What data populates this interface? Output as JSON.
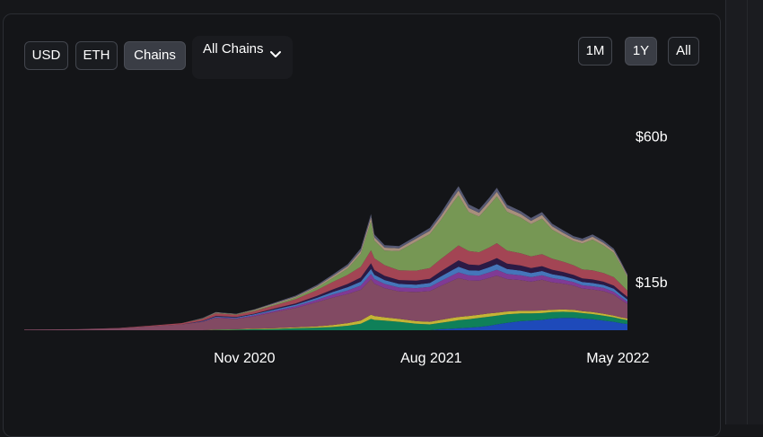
{
  "toolbar": {
    "currency_buttons": [
      "USD",
      "ETH",
      "Chains"
    ],
    "active_currency": "Chains",
    "chain_select": "All Chains",
    "range_buttons": [
      "1M",
      "1Y",
      "All"
    ],
    "active_range": "1Y"
  },
  "chart_data": {
    "type": "area",
    "stacked": true,
    "y_ticks": [
      "$60b",
      "$15b"
    ],
    "y_tick_values": [
      60,
      15
    ],
    "ylim": [
      0,
      66
    ],
    "x_ticks": [
      "Nov 2020",
      "Aug 2021",
      "May 2022"
    ],
    "x_tick_dates": [
      "2020-11-01",
      "2021-08-01",
      "2022-05-01"
    ],
    "x_range": [
      "2019-12-15",
      "2022-05-15"
    ],
    "grid": false,
    "legend": "none",
    "x": [
      "2019-12-15",
      "2020-03-01",
      "2020-05-01",
      "2020-06-15",
      "2020-08-01",
      "2020-09-01",
      "2020-09-20",
      "2020-10-20",
      "2020-11-15",
      "2020-12-15",
      "2021-01-15",
      "2021-02-15",
      "2021-03-10",
      "2021-04-01",
      "2021-04-20",
      "2021-05-05",
      "2021-05-10",
      "2021-05-25",
      "2021-06-15",
      "2021-07-10",
      "2021-07-30",
      "2021-08-15",
      "2021-09-01",
      "2021-09-10",
      "2021-09-25",
      "2021-10-10",
      "2021-10-25",
      "2021-11-05",
      "2021-11-20",
      "2021-12-10",
      "2021-12-25",
      "2022-01-10",
      "2022-01-25",
      "2022-02-10",
      "2022-02-25",
      "2022-03-10",
      "2022-03-25",
      "2022-04-10",
      "2022-04-25",
      "2022-05-05",
      "2022-05-15"
    ],
    "series": [
      {
        "color": "#1f4fc9",
        "values": [
          0,
          0,
          0,
          0,
          0,
          0,
          0,
          0,
          0,
          0,
          0,
          0,
          0,
          0,
          0,
          0,
          0,
          0,
          0,
          0,
          0,
          0.3,
          0.5,
          0.6,
          0.8,
          1.0,
          1.4,
          1.8,
          2.3,
          2.8,
          3.0,
          3.2,
          3.6,
          3.8,
          3.8,
          3.6,
          3.4,
          3.0,
          2.6,
          2.2,
          1.9
        ]
      },
      {
        "color": "#0f8a5f",
        "values": [
          0,
          0,
          0,
          0,
          0,
          0,
          0.1,
          0.2,
          0.3,
          0.4,
          0.6,
          0.8,
          1.0,
          1.4,
          2.0,
          3.5,
          3.2,
          3.0,
          2.6,
          2.0,
          1.8,
          2.0,
          2.3,
          2.5,
          2.6,
          2.8,
          2.8,
          2.7,
          2.6,
          2.4,
          2.2,
          2.1,
          2.0,
          1.9,
          1.8,
          1.7,
          1.6,
          1.5,
          1.4,
          1.3,
          1.2
        ]
      },
      {
        "color": "#d4c23a",
        "values": [
          0,
          0,
          0,
          0,
          0,
          0,
          0.1,
          0.1,
          0.2,
          0.2,
          0.3,
          0.4,
          0.6,
          0.8,
          1.0,
          1.3,
          1.2,
          1.0,
          0.9,
          0.8,
          0.8,
          0.9,
          1.0,
          1.0,
          1.0,
          1.0,
          1.0,
          0.9,
          0.9,
          0.8,
          0.8,
          0.8,
          0.7,
          0.7,
          0.7,
          0.6,
          0.6,
          0.6,
          0.5,
          0.5,
          0.5
        ]
      },
      {
        "color": "#8c4f6a",
        "values": [
          0.2,
          0.3,
          0.6,
          1.2,
          1.8,
          2.6,
          3.6,
          3.2,
          3.8,
          5.0,
          6.0,
          7.5,
          8.5,
          9.0,
          9.5,
          11.0,
          10.0,
          9.0,
          8.5,
          9.0,
          9.5,
          10.5,
          11.5,
          12.0,
          11.0,
          10.5,
          11.0,
          11.5,
          10.0,
          9.5,
          9.0,
          9.5,
          8.5,
          8.0,
          7.5,
          7.0,
          7.0,
          7.0,
          6.5,
          5.5,
          4.5
        ]
      },
      {
        "color": "#8a3ea0",
        "values": [
          0,
          0,
          0,
          0,
          0,
          0.1,
          0.2,
          0.2,
          0.3,
          0.4,
          0.5,
          0.7,
          0.9,
          1.1,
          1.3,
          1.6,
          1.4,
          1.3,
          1.2,
          1.2,
          1.3,
          1.5,
          1.7,
          1.8,
          1.6,
          1.6,
          1.7,
          1.8,
          1.6,
          1.5,
          1.4,
          1.4,
          1.3,
          1.2,
          1.1,
          1.0,
          1.0,
          1.0,
          0.9,
          0.8,
          0.7
        ]
      },
      {
        "color": "#4a7ec9",
        "values": [
          0,
          0,
          0,
          0,
          0,
          0.1,
          0.2,
          0.2,
          0.3,
          0.4,
          0.5,
          0.6,
          0.8,
          1.0,
          1.2,
          1.5,
          1.3,
          1.2,
          1.1,
          1.1,
          1.2,
          1.4,
          1.6,
          1.7,
          1.5,
          1.5,
          1.6,
          1.7,
          1.5,
          1.4,
          1.3,
          1.3,
          1.2,
          1.1,
          1.0,
          1.0,
          1.0,
          0.9,
          0.9,
          0.8,
          0.7
        ]
      },
      {
        "color": "#2e1b4a",
        "values": [
          0,
          0,
          0,
          0,
          0,
          0.1,
          0.2,
          0.2,
          0.2,
          0.3,
          0.4,
          0.6,
          0.8,
          1.0,
          1.3,
          1.8,
          1.5,
          1.3,
          1.2,
          1.2,
          1.3,
          1.6,
          1.8,
          2.0,
          1.8,
          1.7,
          1.8,
          1.9,
          1.7,
          1.6,
          1.5,
          1.5,
          1.4,
          1.3,
          1.2,
          1.1,
          1.1,
          1.0,
          1.0,
          0.9,
          0.8
        ]
      },
      {
        "color": "#b04a5a",
        "values": [
          0,
          0,
          0.1,
          0.2,
          0.4,
          0.6,
          0.8,
          0.7,
          0.8,
          1.0,
          1.3,
          1.8,
          2.3,
          2.8,
          3.3,
          4.0,
          3.6,
          3.3,
          3.0,
          3.1,
          3.3,
          3.8,
          4.3,
          4.6,
          4.2,
          4.0,
          4.3,
          4.6,
          4.0,
          3.8,
          3.6,
          3.7,
          3.4,
          3.2,
          3.0,
          2.8,
          2.8,
          2.7,
          2.6,
          2.3,
          1.9
        ]
      },
      {
        "color": "#7fa35a",
        "values": [
          0,
          0,
          0,
          0,
          0,
          0.1,
          0.1,
          0.1,
          0.2,
          0.3,
          0.5,
          0.8,
          1.2,
          2.0,
          4.0,
          9.0,
          5.5,
          4.5,
          6.0,
          9.0,
          10.5,
          12.0,
          14.5,
          15.5,
          12.0,
          11.0,
          13.0,
          14.5,
          12.0,
          11.0,
          10.0,
          11.0,
          9.0,
          8.0,
          7.5,
          8.0,
          9.5,
          8.5,
          7.5,
          6.0,
          4.2
        ]
      },
      {
        "color": "#b59a86",
        "values": [
          0,
          0,
          0,
          0,
          0,
          0.1,
          0.2,
          0.1,
          0.2,
          0.3,
          0.3,
          0.4,
          0.6,
          0.7,
          0.9,
          1.2,
          1.0,
          0.9,
          0.8,
          0.9,
          1.0,
          1.2,
          1.4,
          1.5,
          1.3,
          1.2,
          1.3,
          1.4,
          1.2,
          1.1,
          1.0,
          1.1,
          1.0,
          0.9,
          0.8,
          0.8,
          0.9,
          0.8,
          0.7,
          0.6,
          0.5
        ]
      },
      {
        "color": "#5c607c",
        "values": [
          0,
          0,
          0,
          0,
          0,
          0.1,
          0.1,
          0.1,
          0.1,
          0.2,
          0.3,
          0.4,
          0.5,
          0.6,
          0.8,
          1.0,
          0.9,
          0.8,
          0.7,
          0.8,
          0.9,
          1.0,
          1.2,
          1.3,
          1.1,
          1.0,
          1.1,
          1.2,
          1.0,
          0.9,
          0.9,
          0.9,
          0.8,
          0.8,
          0.7,
          0.7,
          0.7,
          0.7,
          0.6,
          0.5,
          0.4
        ]
      }
    ]
  }
}
